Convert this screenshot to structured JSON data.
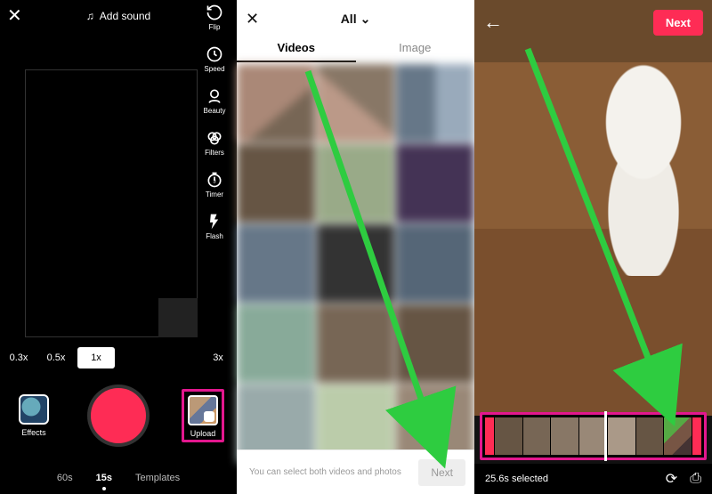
{
  "screen1": {
    "close_icon": "✕",
    "add_sound": "Add sound",
    "tools": {
      "flip": "Flip",
      "speed": "Speed",
      "beauty": "Beauty",
      "filters": "Filters",
      "timer": "Timer",
      "flash": "Flash"
    },
    "zoom": {
      "z03": "0.3x",
      "z05": "0.5x",
      "z1": "1x",
      "z3": "3x"
    },
    "effects_label": "Effects",
    "upload_label": "Upload",
    "durations": {
      "d60": "60s",
      "d15": "15s",
      "templates": "Templates"
    }
  },
  "screen2": {
    "dropdown_title": "All",
    "tabs": {
      "videos": "Videos",
      "image": "Image"
    },
    "hint": "You can select both videos and photos",
    "next": "Next"
  },
  "screen3": {
    "next": "Next",
    "selected": "25.6s selected"
  }
}
